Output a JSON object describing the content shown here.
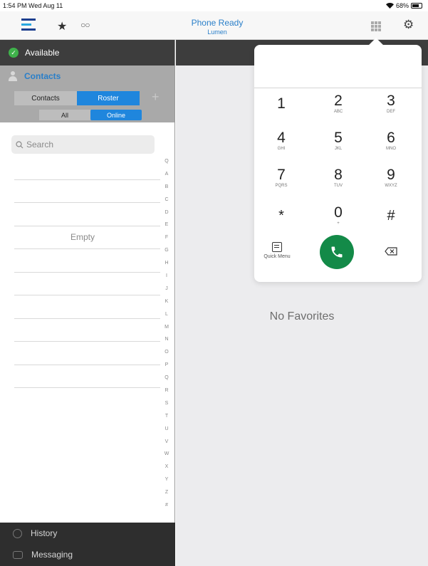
{
  "status_bar": {
    "time": "1:54 PM  Wed Aug 11",
    "wifi": "wifi-icon",
    "battery": "68%"
  },
  "toolbar": {
    "title": "Phone Ready",
    "subtitle": "Lumen",
    "icons": [
      "app-logo-icon",
      "star-icon",
      "voicemail-icon",
      "dialpad-grid-icon",
      "gear-icon"
    ]
  },
  "presence": {
    "label": "Available",
    "color": "#3fb24b"
  },
  "contacts": {
    "header": "Contacts",
    "segment1": [
      "Contacts",
      "Roster"
    ],
    "segment1_selected": "Roster",
    "segment2": [
      "All",
      "Online"
    ],
    "segment2_selected": "Online",
    "search_placeholder": "Search",
    "empty_text": "Empty",
    "index": [
      "Q",
      "A",
      "B",
      "C",
      "D",
      "E",
      "F",
      "G",
      "H",
      "I",
      "J",
      "K",
      "L",
      "M",
      "N",
      "O",
      "P",
      "Q",
      "R",
      "S",
      "T",
      "U",
      "V",
      "W",
      "X",
      "Y",
      "Z",
      "#"
    ]
  },
  "bottom_nav": [
    {
      "label": "History",
      "icon": "clock-icon"
    },
    {
      "label": "Messaging",
      "icon": "chat-bubble-icon"
    }
  ],
  "favorites": {
    "empty_text": "No Favorites"
  },
  "dialpad": {
    "keys": [
      {
        "digit": "1",
        "letters": ""
      },
      {
        "digit": "2",
        "letters": "ABC"
      },
      {
        "digit": "3",
        "letters": "DEF"
      },
      {
        "digit": "4",
        "letters": "GHI"
      },
      {
        "digit": "5",
        "letters": "JKL"
      },
      {
        "digit": "6",
        "letters": "MNO"
      },
      {
        "digit": "7",
        "letters": "PQRS"
      },
      {
        "digit": "8",
        "letters": "TUV"
      },
      {
        "digit": "9",
        "letters": "WXYZ"
      },
      {
        "digit": "*",
        "letters": ""
      },
      {
        "digit": "0",
        "letters": "+"
      },
      {
        "digit": "#",
        "letters": ""
      }
    ],
    "quick_menu_label": "Quick Menu",
    "call_color": "#138a48"
  },
  "colors": {
    "accent": "#1f86dd",
    "title_blue": "#2a7fc9",
    "dark": "#3d3d3d"
  }
}
